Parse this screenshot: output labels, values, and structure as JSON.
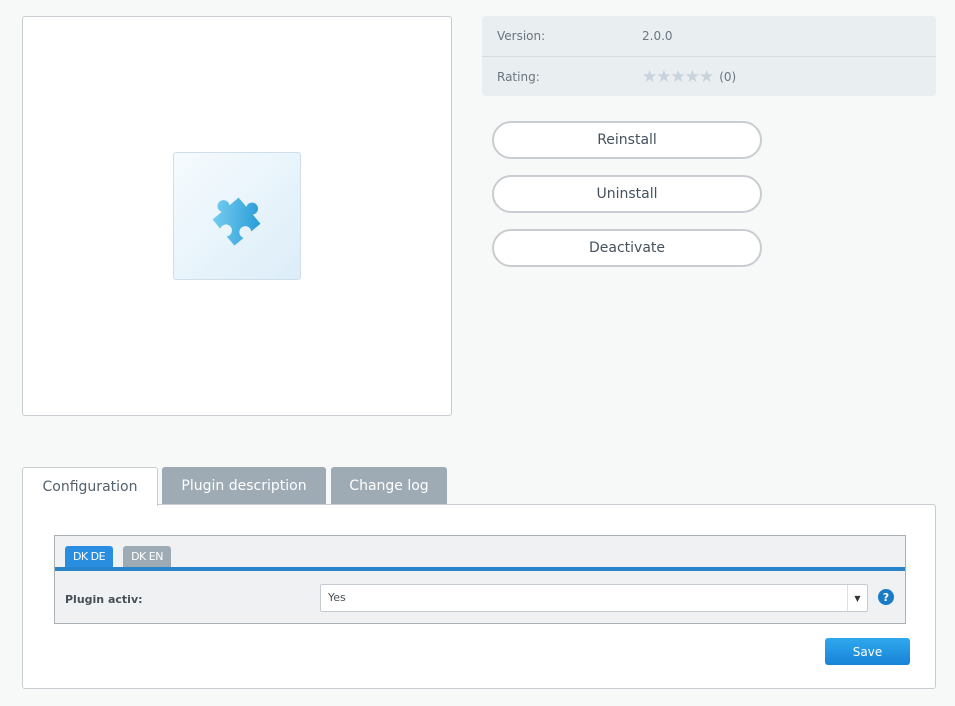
{
  "plugin": {
    "icon": "puzzle-piece-icon"
  },
  "info": {
    "version_label": "Version:",
    "version_value": "2.0.0",
    "rating_label": "Rating:",
    "rating_stars": "★★★★★",
    "rating_value": 0,
    "rating_count": "(0)"
  },
  "actions": {
    "reinstall": "Reinstall",
    "uninstall": "Uninstall",
    "deactivate": "Deactivate"
  },
  "tabs": [
    {
      "label": "Configuration",
      "active": true
    },
    {
      "label": "Plugin description"
    },
    {
      "label": "Change log"
    }
  ],
  "config": {
    "subtabs": [
      {
        "label": "DK DE",
        "active": true
      },
      {
        "label": "DK EN"
      }
    ],
    "field_label": "Plugin activ:",
    "field_value": "Yes",
    "help": "?",
    "save": "Save"
  },
  "colors": {
    "accent": "#2a84c9",
    "inactive_tab": "#9eabb5"
  }
}
